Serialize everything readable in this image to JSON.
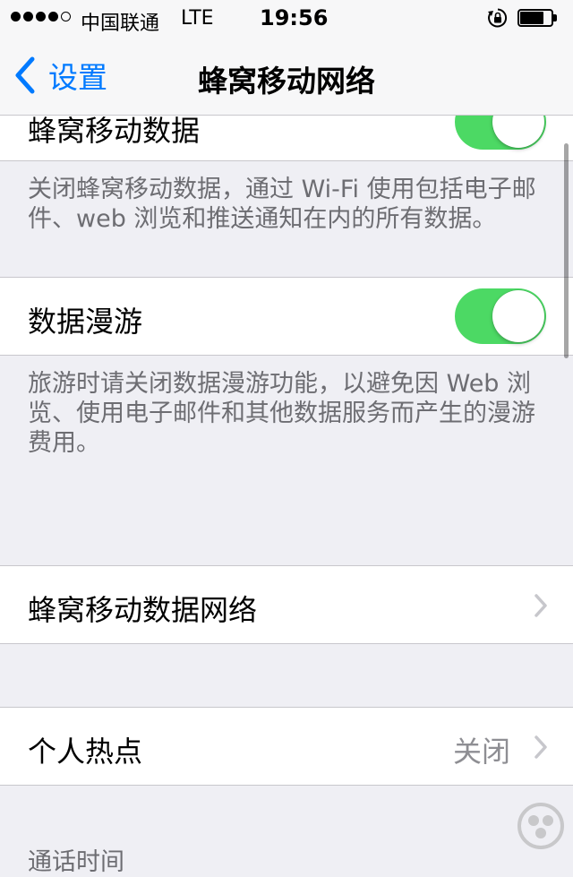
{
  "status_bar": {
    "carrier": "中国联通",
    "network": "LTE",
    "time": "19:56",
    "signal_bars_filled": 4,
    "signal_bars_total": 5,
    "battery_level": 0.75
  },
  "nav": {
    "back_label": "设置",
    "title": "蜂窝移动网络"
  },
  "cellular_data": {
    "label": "蜂窝移动数据",
    "enabled": true,
    "footer": "关闭蜂窝移动数据，通过 Wi-Fi 使用包括电子邮件、web 浏览和推送通知在内的所有数据。"
  },
  "roaming": {
    "label": "数据漫游",
    "enabled": true,
    "footer": "旅游时请关闭数据漫游功能，以避免因 Web 浏览、使用电子邮件和其他数据服务而产生的漫游费用。"
  },
  "cellular_network": {
    "label": "蜂窝移动数据网络"
  },
  "hotspot": {
    "label": "个人热点",
    "value": "关闭"
  },
  "call_time": {
    "header": "通话时间"
  },
  "colors": {
    "accent": "#007aff",
    "toggle_on": "#4cd964",
    "background": "#efeff4",
    "secondary_text": "#6d6d72"
  }
}
